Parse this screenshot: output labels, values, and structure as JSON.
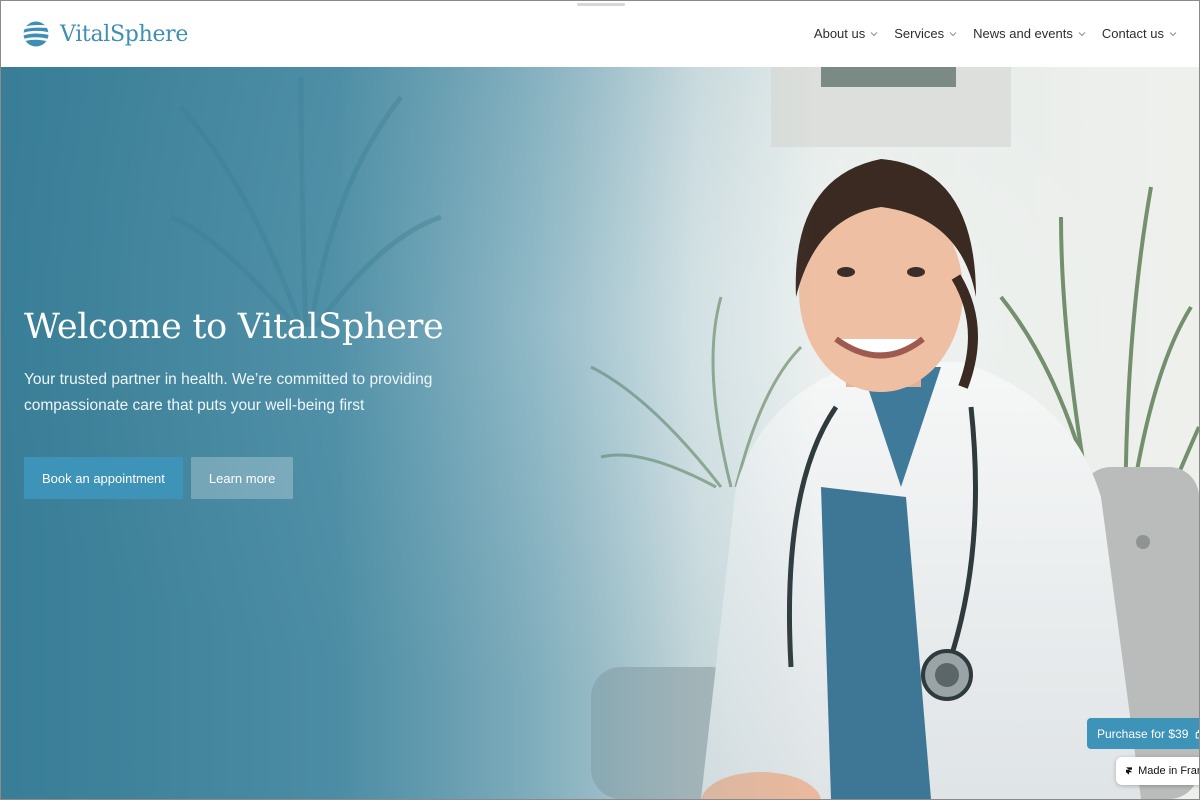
{
  "brand": {
    "name": "VitalSphere",
    "color": "#3f8fb5",
    "logo_icon": "globe-stripes-icon"
  },
  "nav": {
    "items": [
      {
        "label": "About us",
        "icon": "chevron-down-icon"
      },
      {
        "label": "Services",
        "icon": "chevron-down-icon"
      },
      {
        "label": "News and events",
        "icon": "chevron-down-icon"
      },
      {
        "label": "Contact us",
        "icon": "chevron-down-icon"
      }
    ]
  },
  "hero": {
    "title": "Welcome to VitalSphere",
    "subtitle_line1": "Your trusted partner in health. We’re committed to providing",
    "subtitle_line2": "compassionate care that puts your well-being first",
    "image": "smiling-doctor-in-white-coat-with-stethoscope-photo",
    "primary_cta": "Book an appointment",
    "secondary_cta": "Learn more"
  },
  "widgets": {
    "purchase_label": "Purchase for $39",
    "purchase_icon": "bag-icon",
    "made_in_label": "Made in Fram",
    "made_in_icon": "framer-logo-icon"
  },
  "colors": {
    "accent": "#3e93b8",
    "hero_overlay": "#347c96",
    "text_dark": "#2a2f33"
  }
}
